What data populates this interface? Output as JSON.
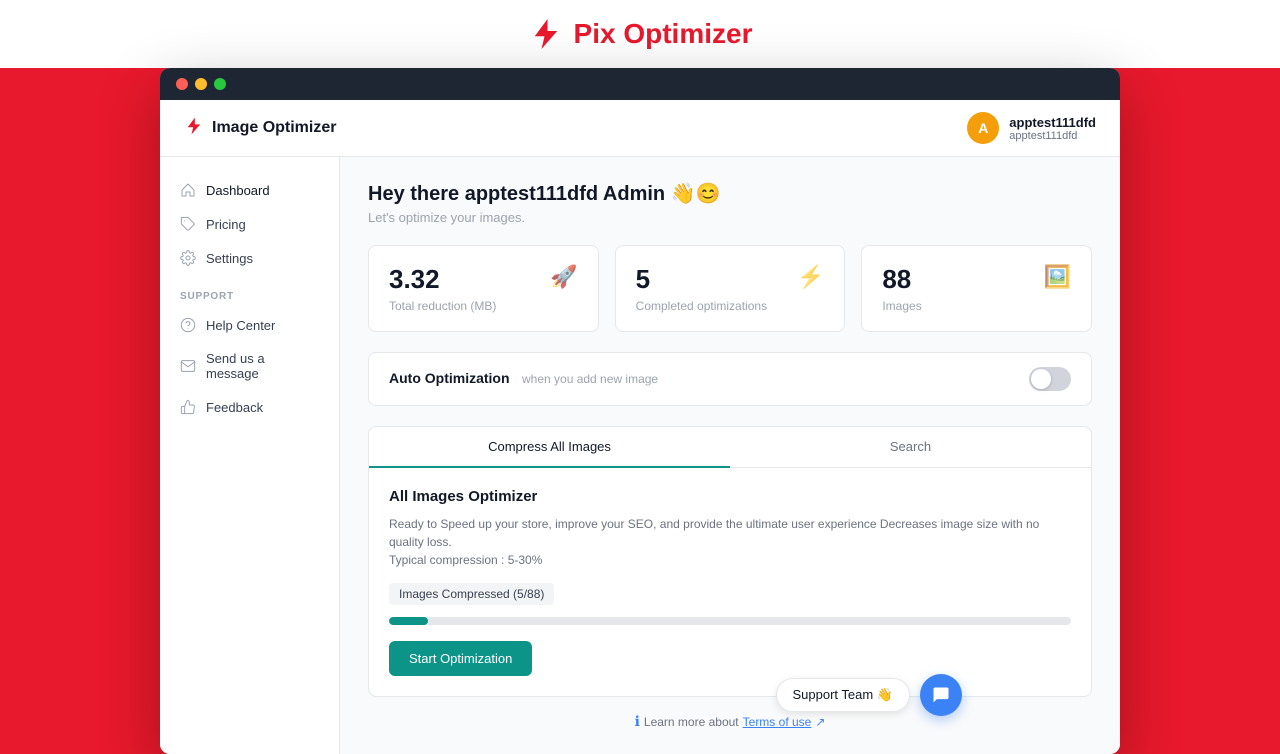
{
  "brand": {
    "title": "Pix Optimizer"
  },
  "app": {
    "title": "Image Optimizer",
    "header": {
      "user": {
        "name": "apptest111dfd",
        "email": "apptest111dfd",
        "avatar_initial": "A"
      }
    }
  },
  "sidebar": {
    "nav_items": [
      {
        "label": "Dashboard",
        "icon": "home-icon",
        "active": true
      },
      {
        "label": "Pricing",
        "icon": "tag-icon",
        "active": false
      },
      {
        "label": "Settings",
        "icon": "settings-icon",
        "active": false
      }
    ],
    "support_section_label": "SUPPORT",
    "support_items": [
      {
        "label": "Help Center",
        "icon": "help-circle-icon"
      },
      {
        "label": "Send us a message",
        "icon": "mail-icon"
      },
      {
        "label": "Feedback",
        "icon": "thumbsup-icon"
      }
    ]
  },
  "main": {
    "greeting": "Hey there apptest111dfd Admin 👋😊",
    "subtitle": "Let's optimize your images.",
    "stats": [
      {
        "value": "3.32",
        "label": "Total reduction (MB)",
        "icon": "🚀"
      },
      {
        "value": "5",
        "label": "Completed optimizations",
        "icon": "⚡"
      },
      {
        "value": "88",
        "label": "Images",
        "icon": "🖼️"
      }
    ],
    "auto_optimization": {
      "label": "Auto Optimization",
      "sublabel": "when you add new image",
      "enabled": false
    },
    "tabs": [
      {
        "label": "Compress All Images",
        "active": true
      },
      {
        "label": "Search",
        "active": false
      }
    ],
    "optimizer": {
      "title": "All Images Optimizer",
      "description": "Ready to Speed up your store, improve your SEO, and provide the ultimate user experience Decreases image size with no quality loss.",
      "compression_note": "Typical compression : 5-30%",
      "badge_text": "Images Compressed (5/88)",
      "progress_pct": 5.68,
      "start_button": "Start Optimization"
    }
  },
  "footer": {
    "learn_more_text": "Learn more about",
    "terms_link": "Terms of use"
  },
  "support": {
    "label": "Support Team 👋",
    "chat_icon": "chat-icon"
  }
}
